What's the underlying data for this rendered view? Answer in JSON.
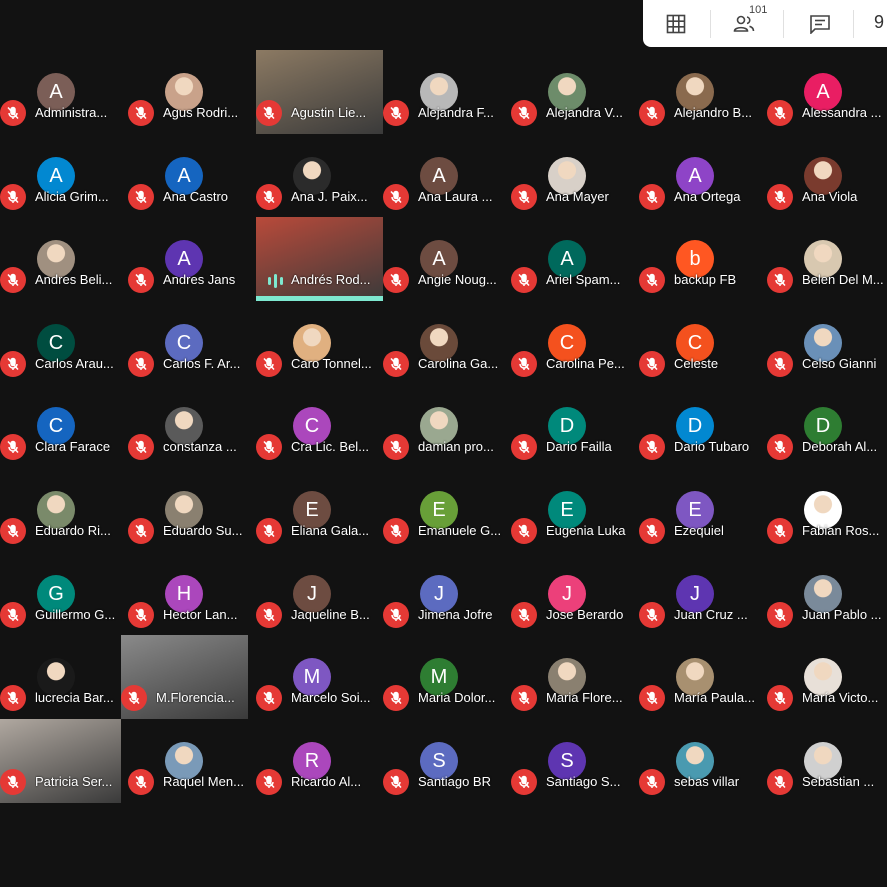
{
  "toolbar": {
    "participants_count": "101",
    "more_text": "9"
  },
  "colors": {
    "background": "#121212",
    "mic_muted": "#e53935"
  },
  "participants": [
    {
      "name": "Administra...",
      "initial": "A",
      "color": "#7b5e57",
      "type": "avatar"
    },
    {
      "name": "Agus Rodri...",
      "initial": "",
      "color": "#c9a28a",
      "type": "photo"
    },
    {
      "name": "Agustin Lie...",
      "initial": "",
      "color": "#8c7a63",
      "type": "video"
    },
    {
      "name": "Alejandra F...",
      "initial": "",
      "color": "#b8b8b8",
      "type": "photo"
    },
    {
      "name": "Alejandra V...",
      "initial": "",
      "color": "#6d8c6a",
      "type": "photo"
    },
    {
      "name": "Alejandro B...",
      "initial": "",
      "color": "#8a6a4e",
      "type": "photo"
    },
    {
      "name": "Alessandra ...",
      "initial": "A",
      "color": "#e91e63",
      "type": "avatar"
    },
    {
      "name": "Alicia Grim...",
      "initial": "A",
      "color": "#0288d1",
      "type": "avatar"
    },
    {
      "name": "Ana Castro",
      "initial": "A",
      "color": "#1565c0",
      "type": "avatar"
    },
    {
      "name": "Ana J. Paix...",
      "initial": "",
      "color": "#2b2b2b",
      "type": "photo"
    },
    {
      "name": "Ana Laura ...",
      "initial": "A",
      "color": "#6d4c41",
      "type": "avatar"
    },
    {
      "name": "Ana Mayer",
      "initial": "",
      "color": "#d8d0c8",
      "type": "photo"
    },
    {
      "name": "Ana Ortega",
      "initial": "A",
      "color": "#8e44c7",
      "type": "avatar"
    },
    {
      "name": "Ana Viola",
      "initial": "",
      "color": "#7a3b2e",
      "type": "photo"
    },
    {
      "name": "Andres Beli...",
      "initial": "",
      "color": "#a09080",
      "type": "photo"
    },
    {
      "name": "Andres Jans",
      "initial": "A",
      "color": "#5e35b1",
      "type": "avatar"
    },
    {
      "name": "Andrés Rod...",
      "initial": "",
      "color": "#b94a3a",
      "type": "video"
    },
    {
      "name": "Angie Noug...",
      "initial": "A",
      "color": "#6d4c41",
      "type": "avatar"
    },
    {
      "name": "Ariel Spam...",
      "initial": "A",
      "color": "#00695c",
      "type": "avatar"
    },
    {
      "name": "backup FB",
      "initial": "b",
      "color": "#ff5722",
      "type": "avatar"
    },
    {
      "name": "Belen Del M...",
      "initial": "",
      "color": "#d8c8b0",
      "type": "photo"
    },
    {
      "name": "Carlos Arau...",
      "initial": "C",
      "color": "#004d40",
      "type": "avatar"
    },
    {
      "name": "Carlos F. Ar...",
      "initial": "C",
      "color": "#5c6bc0",
      "type": "avatar"
    },
    {
      "name": "Caro Tonnel...",
      "initial": "",
      "color": "#e0b080",
      "type": "photo"
    },
    {
      "name": "Carolina Ga...",
      "initial": "",
      "color": "#6a4a3a",
      "type": "photo"
    },
    {
      "name": "Carolina Pe...",
      "initial": "C",
      "color": "#f4511e",
      "type": "avatar"
    },
    {
      "name": "Celeste",
      "initial": "C",
      "color": "#f4511e",
      "type": "avatar"
    },
    {
      "name": "Celso Gianni",
      "initial": "",
      "color": "#6a90b8",
      "type": "photo"
    },
    {
      "name": "Clara Farace",
      "initial": "C",
      "color": "#1565c0",
      "type": "avatar"
    },
    {
      "name": "constanza ...",
      "initial": "",
      "color": "#5a5a5a",
      "type": "photo"
    },
    {
      "name": "Cra Lic. Bel...",
      "initial": "C",
      "color": "#ab47bc",
      "type": "avatar"
    },
    {
      "name": "damian pro...",
      "initial": "",
      "color": "#9aa890",
      "type": "photo"
    },
    {
      "name": "Dario Failla",
      "initial": "D",
      "color": "#00897b",
      "type": "avatar"
    },
    {
      "name": "Dario Tubaro",
      "initial": "D",
      "color": "#0288d1",
      "type": "avatar"
    },
    {
      "name": "Deborah Al...",
      "initial": "D",
      "color": "#2e7d32",
      "type": "avatar"
    },
    {
      "name": "Eduardo Ri...",
      "initial": "",
      "color": "#7a8a6a",
      "type": "photo"
    },
    {
      "name": "Eduardo Su...",
      "initial": "",
      "color": "#8a8070",
      "type": "photo"
    },
    {
      "name": "Eliana Gala...",
      "initial": "E",
      "color": "#6d4c41",
      "type": "avatar"
    },
    {
      "name": "Emanuele G...",
      "initial": "E",
      "color": "#689f38",
      "type": "avatar"
    },
    {
      "name": "Eugenia Luka",
      "initial": "E",
      "color": "#00897b",
      "type": "avatar"
    },
    {
      "name": "Ezequiel",
      "initial": "E",
      "color": "#7e57c2",
      "type": "avatar"
    },
    {
      "name": "Fabian Ros...",
      "initial": "",
      "color": "#ffffff",
      "type": "photo"
    },
    {
      "name": "Guillermo G...",
      "initial": "G",
      "color": "#00897b",
      "type": "avatar"
    },
    {
      "name": "Hector Lan...",
      "initial": "H",
      "color": "#ab47bc",
      "type": "avatar"
    },
    {
      "name": "Jaqueline B...",
      "initial": "J",
      "color": "#6d4c41",
      "type": "avatar"
    },
    {
      "name": "Jimena Jofre",
      "initial": "J",
      "color": "#5c6bc0",
      "type": "avatar"
    },
    {
      "name": "Jose Berardo",
      "initial": "J",
      "color": "#ec407a",
      "type": "avatar"
    },
    {
      "name": "Juan Cruz ...",
      "initial": "J",
      "color": "#5e35b1",
      "type": "avatar"
    },
    {
      "name": "Juan Pablo ...",
      "initial": "",
      "color": "#7a8a9a",
      "type": "photo"
    },
    {
      "name": "lucrecia Bar...",
      "initial": "",
      "color": "#1a1a1a",
      "type": "photo"
    },
    {
      "name": "M.Florencia...",
      "initial": "",
      "color": "#8a8a8a",
      "type": "video"
    },
    {
      "name": "Marcelo Soi...",
      "initial": "M",
      "color": "#7e57c2",
      "type": "avatar"
    },
    {
      "name": "Maria Dolor...",
      "initial": "M",
      "color": "#2e7d32",
      "type": "avatar"
    },
    {
      "name": "Maria Flore...",
      "initial": "",
      "color": "#8a8070",
      "type": "photo"
    },
    {
      "name": "María Paula...",
      "initial": "",
      "color": "#a89070",
      "type": "photo"
    },
    {
      "name": "María Victo...",
      "initial": "",
      "color": "#e8e0d8",
      "type": "photo"
    },
    {
      "name": "Patricia Ser...",
      "initial": "",
      "color": "#b0a8a0",
      "type": "video"
    },
    {
      "name": "Raquel Men...",
      "initial": "",
      "color": "#7a9ab8",
      "type": "photo"
    },
    {
      "name": "Ricardo Al...",
      "initial": "R",
      "color": "#ab47bc",
      "type": "avatar"
    },
    {
      "name": "Santiago BR",
      "initial": "S",
      "color": "#5c6bc0",
      "type": "avatar"
    },
    {
      "name": "Santiago S...",
      "initial": "S",
      "color": "#5e35b1",
      "type": "avatar"
    },
    {
      "name": "sebas villar",
      "initial": "",
      "color": "#4a9ab0",
      "type": "photo"
    },
    {
      "name": "Sebastian ...",
      "initial": "",
      "color": "#d0d0d0",
      "type": "photo"
    }
  ]
}
